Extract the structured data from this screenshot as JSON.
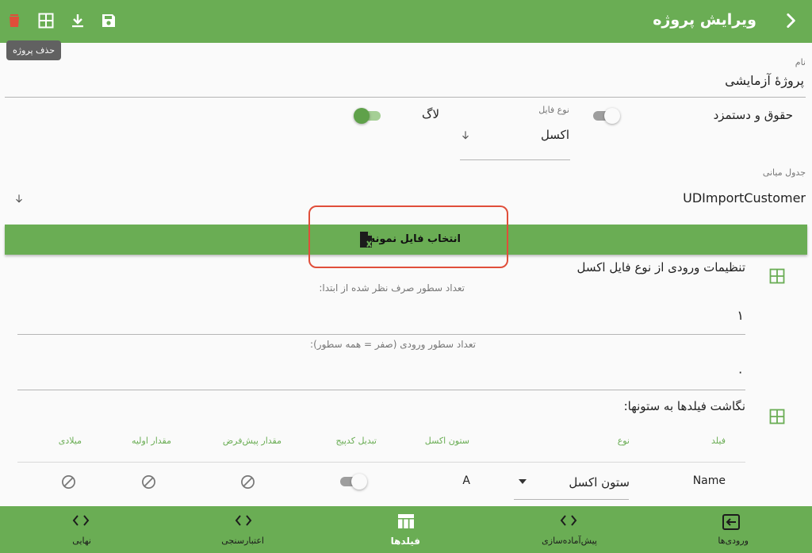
{
  "header": {
    "title": "ویرایش پروژه",
    "tooltip": "حذف پروژه",
    "icons": [
      "delete-icon",
      "table-icon",
      "download-icon",
      "save-icon"
    ],
    "delete_color": "#e04e3a"
  },
  "form": {
    "name_label": "نام",
    "name_value": "پروژهٔ آزمایشی",
    "rights_label": "حقوق و دستمزد",
    "file_type_label": "نوع فایل",
    "file_type_value": "اکسل",
    "log_label": "لاگ",
    "middle_table_label": "جدول میانی",
    "middle_table_value": "UDImportCustomer"
  },
  "select_button_label": "انتخاب فایل نمونه",
  "excel_settings": {
    "title": "تنظیمات ورودی از نوع فایل اکسل",
    "skip_rows_label": "تعداد سطور صرف نظر شده از ابتدا:",
    "skip_rows_value": "۱",
    "input_rows_label": "تعداد سطور ورودی (صفر = همه سطور):",
    "input_rows_value": "۰"
  },
  "mapping": {
    "title": "نگاشت فیلدها به ستونها:",
    "headers": {
      "field": "فیلد",
      "type": "نوع",
      "excel_column": "ستون اکسل",
      "convert_codepage": "تبدیل کدپیج",
      "default_value": "مقدار پیش‌فرض",
      "initial_value": "مقدار اولیه",
      "gregorian": "میلادی"
    },
    "row": {
      "field": "Name",
      "type": "ستون اکسل",
      "excel_column": "A"
    }
  },
  "nav": {
    "inputs": "ورودی‌ها",
    "preprocess": "پیش‌آماده‌سازی",
    "fields": "فیلدها",
    "validation": "اعتبارسنجی",
    "final": "نهایی"
  },
  "colors": {
    "primary": "#6aad54",
    "highlight": "#e04e3a"
  }
}
